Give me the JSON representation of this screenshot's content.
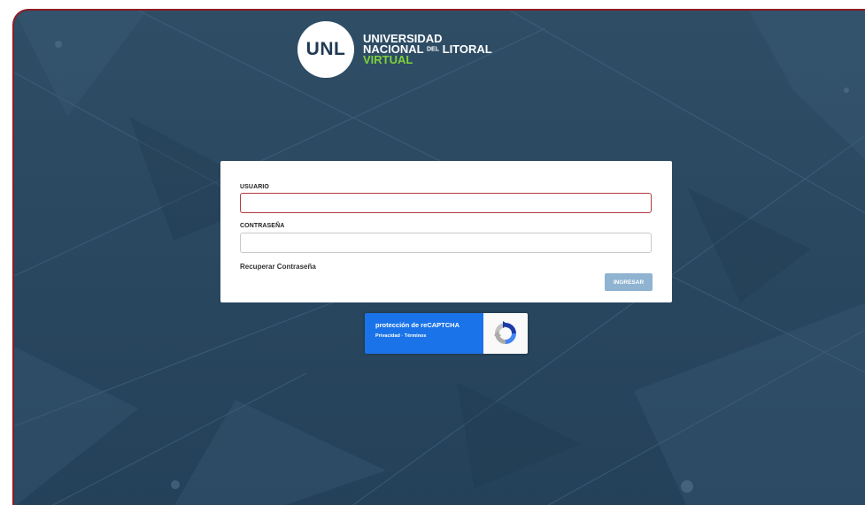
{
  "brand": {
    "logo_text": "UNL",
    "line1": "UNIVERSIDAD",
    "line2_main": "NACIONAL",
    "line2_small": "DEL",
    "line2_end": "LITORAL",
    "line3": "VIRTUAL"
  },
  "login": {
    "username_label": "USUARIO",
    "username_value": "",
    "password_label": "CONTRASEÑA",
    "password_value": "",
    "recover_link": "Recuperar Contraseña",
    "submit_label": "INGRESAR"
  },
  "recaptcha": {
    "title": "protección de reCAPTCHA",
    "links": "Privacidad · Términos"
  },
  "colors": {
    "background": "#2a4860",
    "accent_green": "#7fd13b",
    "frame_border": "#8d1c22",
    "input_error_border": "#b2383e",
    "submit_button": "#8fb3d1",
    "recaptcha_blue": "#1a73e8"
  }
}
